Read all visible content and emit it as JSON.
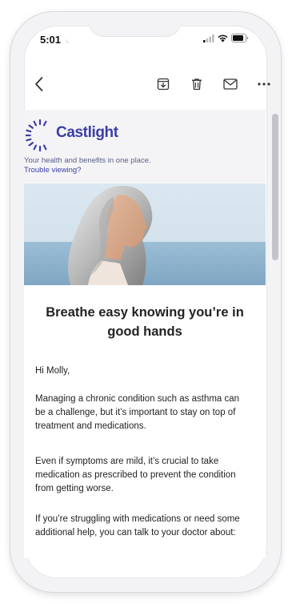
{
  "status_bar": {
    "time": "5:01",
    "icons": [
      "moon-icon",
      "cellular-signal-icon",
      "wifi-icon",
      "battery-icon"
    ]
  },
  "toolbar": {
    "icons": [
      "back-chevron-icon",
      "archive-icon",
      "trash-icon",
      "mail-icon",
      "more-icon"
    ]
  },
  "email": {
    "brand": "Castlight",
    "tagline": "Your health and benefits in one place.",
    "trouble_link": "Trouble viewing?",
    "headline": "Breathe easy knowing you’re in good hands",
    "greeting": "Hi Molly,",
    "paragraphs": [
      "Managing a chronic condition such as asthma can be a challenge, but it’s important to stay on top of treatment and medications.",
      "Even if symptoms are mild, it’s crucial to take medication as prescribed to prevent the condition from getting worse.",
      "If you’re struggling with medications or need some additional help, you can talk to your doctor about:"
    ]
  },
  "colors": {
    "brand": "#3b3fa6",
    "header_band": "#f4f4f6",
    "text": "#222222"
  }
}
